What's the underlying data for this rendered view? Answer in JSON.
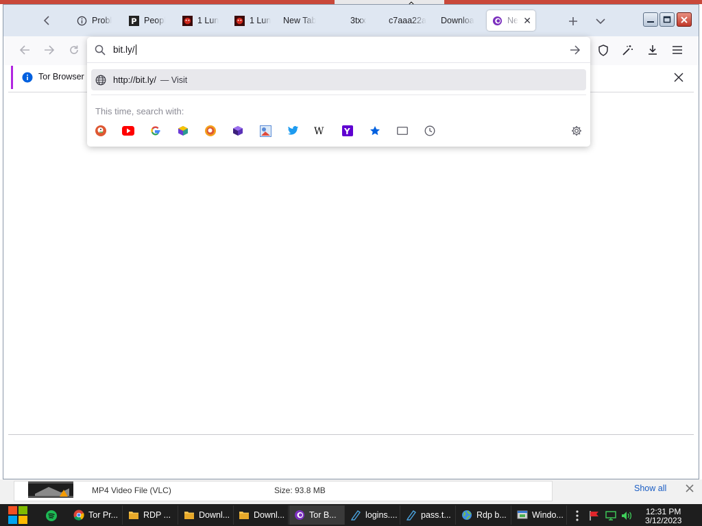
{
  "tabs": [
    {
      "title": "Probl",
      "icon": "info-icon"
    },
    {
      "title": "Peopl",
      "icon": "p-logo-icon"
    },
    {
      "title": "1 Lun",
      "icon": "red-creature-icon"
    },
    {
      "title": "1 Lun",
      "icon": "red-creature-icon"
    },
    {
      "title": "New Tab",
      "icon": ""
    },
    {
      "title": "3txx",
      "icon": ""
    },
    {
      "title": "c7aaa22a",
      "icon": ""
    },
    {
      "title": "Downloa",
      "icon": ""
    },
    {
      "title": "Ne",
      "icon": "tor-onion-icon",
      "active": true
    }
  ],
  "urlbar": {
    "value": "bit.ly/",
    "suggestion_url": "http://bit.ly/",
    "suggestion_action": "— Visit",
    "search_with_label": "This time, search with:",
    "engines": [
      "duckduckgo-icon",
      "youtube-icon",
      "google-icon",
      "cube-engine-icon",
      "ddg-onion-icon",
      "purple-cube-icon",
      "image-search-icon",
      "twitter-icon",
      "wikipedia-icon",
      "yahoo-icon",
      "bookmarks-star-icon",
      "tabs-icon",
      "history-clock-icon"
    ]
  },
  "notification": {
    "text": "Tor Browser"
  },
  "download": {
    "type": "MP4 Video File (VLC)",
    "size": "Size: 93.8 MB",
    "show_all": "Show all"
  },
  "taskbar": {
    "items": [
      {
        "label": "Tor Pr...",
        "icon": "chrome-icon"
      },
      {
        "label": "RDP ...",
        "icon": "folder-icon"
      },
      {
        "label": "Downl...",
        "icon": "folder-icon"
      },
      {
        "label": "Downl...",
        "icon": "folder-icon"
      },
      {
        "label": "Tor B...",
        "icon": "tor-onion-icon",
        "active": true
      },
      {
        "label": "logins....",
        "icon": "notepad-icon"
      },
      {
        "label": "pass.t...",
        "icon": "notepad-icon"
      },
      {
        "label": "Rdp b...",
        "icon": "globe-icon"
      },
      {
        "label": "Windo...",
        "icon": "app-window-icon"
      }
    ],
    "time": "12:31 PM",
    "date": "3/12/2023"
  },
  "colors": {
    "tor_purple": "#7b2fbe",
    "tab_bar": "#dfe7f2",
    "taskbar": "#1e1e1e",
    "accent_blue": "#0060df"
  }
}
